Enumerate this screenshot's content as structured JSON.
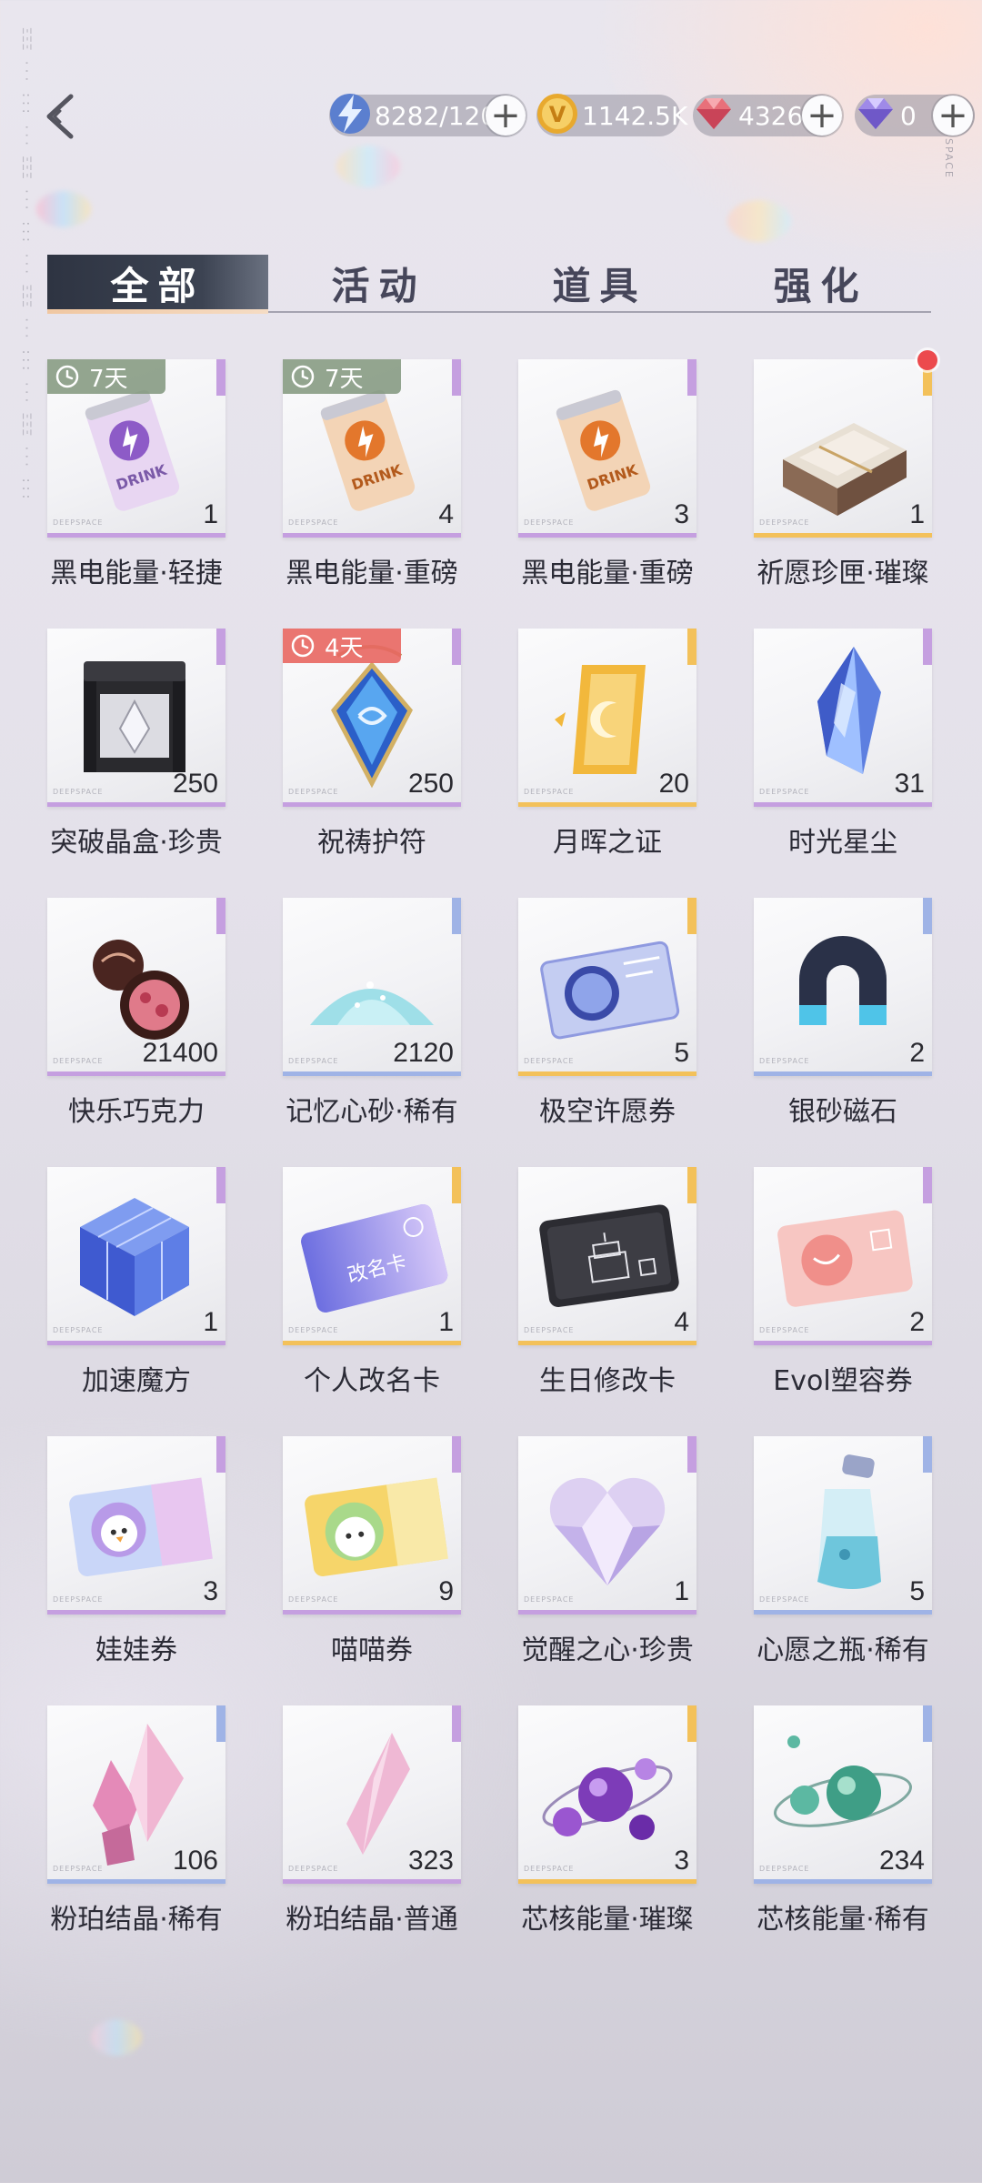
{
  "topbar": {
    "currencies": [
      {
        "name": "stamina",
        "value": "8282/120",
        "icon": "lightning-icon",
        "has_plus": true
      },
      {
        "name": "gold",
        "value": "1142.5K",
        "icon": "gold-coin-icon",
        "has_plus": false
      },
      {
        "name": "crystal",
        "value": "4326",
        "icon": "red-diamond-icon",
        "has_plus": true
      },
      {
        "name": "diamond",
        "value": "0",
        "icon": "purple-diamond-icon",
        "has_plus": true
      }
    ],
    "space_text": "SPACE"
  },
  "tabs": [
    {
      "label": "全部",
      "active": true
    },
    {
      "label": "活动",
      "active": false
    },
    {
      "label": "道具",
      "active": false
    },
    {
      "label": "强化",
      "active": false
    }
  ],
  "items": [
    {
      "name": "黑电能量·轻捷",
      "qty": "1",
      "rarity": "purple",
      "badge": "7天",
      "badge_color": "green",
      "icon": "purple-drink-can-icon"
    },
    {
      "name": "黑电能量·重磅",
      "qty": "4",
      "rarity": "purple",
      "badge": "7天",
      "badge_color": "green",
      "icon": "orange-drink-can-icon"
    },
    {
      "name": "黑电能量·重磅",
      "qty": "3",
      "rarity": "purple",
      "badge": "",
      "badge_color": "",
      "icon": "orange-drink-can-icon"
    },
    {
      "name": "祈愿珍匣·璀璨",
      "qty": "1",
      "rarity": "gold",
      "badge": "",
      "badge_color": "",
      "icon": "gift-box-icon",
      "red_dot": true
    },
    {
      "name": "突破晶盒·珍贵",
      "qty": "250",
      "rarity": "purple",
      "badge": "",
      "badge_color": "",
      "icon": "crystal-box-icon"
    },
    {
      "name": "祝祷护符",
      "qty": "250",
      "rarity": "purple",
      "badge": "4天",
      "badge_color": "red",
      "icon": "amulet-icon"
    },
    {
      "name": "月晖之证",
      "qty": "20",
      "rarity": "gold",
      "badge": "",
      "badge_color": "",
      "icon": "moon-card-icon"
    },
    {
      "name": "时光星尘",
      "qty": "31",
      "rarity": "purple",
      "badge": "",
      "badge_color": "",
      "icon": "blue-crystal-icon"
    },
    {
      "name": "快乐巧克力",
      "qty": "21400",
      "rarity": "purple",
      "badge": "",
      "badge_color": "",
      "icon": "chocolate-icon"
    },
    {
      "name": "记忆心砂·稀有",
      "qty": "2120",
      "rarity": "blue",
      "badge": "",
      "badge_color": "",
      "icon": "sand-pile-icon"
    },
    {
      "name": "极空许愿券",
      "qty": "5",
      "rarity": "gold",
      "badge": "",
      "badge_color": "",
      "icon": "wish-ticket-icon"
    },
    {
      "name": "银砂磁石",
      "qty": "2",
      "rarity": "blue",
      "badge": "",
      "badge_color": "",
      "icon": "magnet-icon"
    },
    {
      "name": "加速魔方",
      "qty": "1",
      "rarity": "purple",
      "badge": "",
      "badge_color": "",
      "icon": "cube-icon"
    },
    {
      "name": "个人改名卡",
      "qty": "1",
      "rarity": "gold",
      "badge": "",
      "badge_color": "",
      "icon": "rename-card-icon",
      "card_text": "改名卡"
    },
    {
      "name": "生日修改卡",
      "qty": "4",
      "rarity": "gold",
      "badge": "",
      "badge_color": "",
      "icon": "birthday-card-icon"
    },
    {
      "name": "Evol塑容券",
      "qty": "2",
      "rarity": "purple",
      "badge": "",
      "badge_color": "",
      "icon": "face-ticket-icon"
    },
    {
      "name": "娃娃券",
      "qty": "3",
      "rarity": "purple",
      "badge": "",
      "badge_color": "",
      "icon": "doll-ticket-icon"
    },
    {
      "name": "喵喵券",
      "qty": "9",
      "rarity": "purple",
      "badge": "",
      "badge_color": "",
      "icon": "cat-ticket-icon"
    },
    {
      "name": "觉醒之心·珍贵",
      "qty": "1",
      "rarity": "purple",
      "badge": "",
      "badge_color": "",
      "icon": "heart-gem-icon"
    },
    {
      "name": "心愿之瓶·稀有",
      "qty": "5",
      "rarity": "blue",
      "badge": "",
      "badge_color": "",
      "icon": "bottle-icon"
    },
    {
      "name": "粉珀结晶·稀有",
      "qty": "106",
      "rarity": "blue",
      "badge": "",
      "badge_color": "",
      "icon": "pink-crystal-cluster-icon"
    },
    {
      "name": "粉珀结晶·普通",
      "qty": "323",
      "rarity": "purple",
      "badge": "",
      "badge_color": "",
      "icon": "pink-crystal-icon"
    },
    {
      "name": "芯核能量·璀璨",
      "qty": "3",
      "rarity": "gold",
      "badge": "",
      "badge_color": "",
      "icon": "purple-orbs-icon"
    },
    {
      "name": "芯核能量·稀有",
      "qty": "234",
      "rarity": "blue",
      "badge": "",
      "badge_color": "",
      "icon": "green-orbs-icon"
    }
  ],
  "card_watermark": "DEEPSPACE",
  "colors": {
    "purple": "#c59fe0",
    "gold": "#f3c15a",
    "blue": "#9fb3e6",
    "badge_green": "#849880",
    "badge_red": "#e8695f",
    "tab_active": "#2e3442"
  }
}
